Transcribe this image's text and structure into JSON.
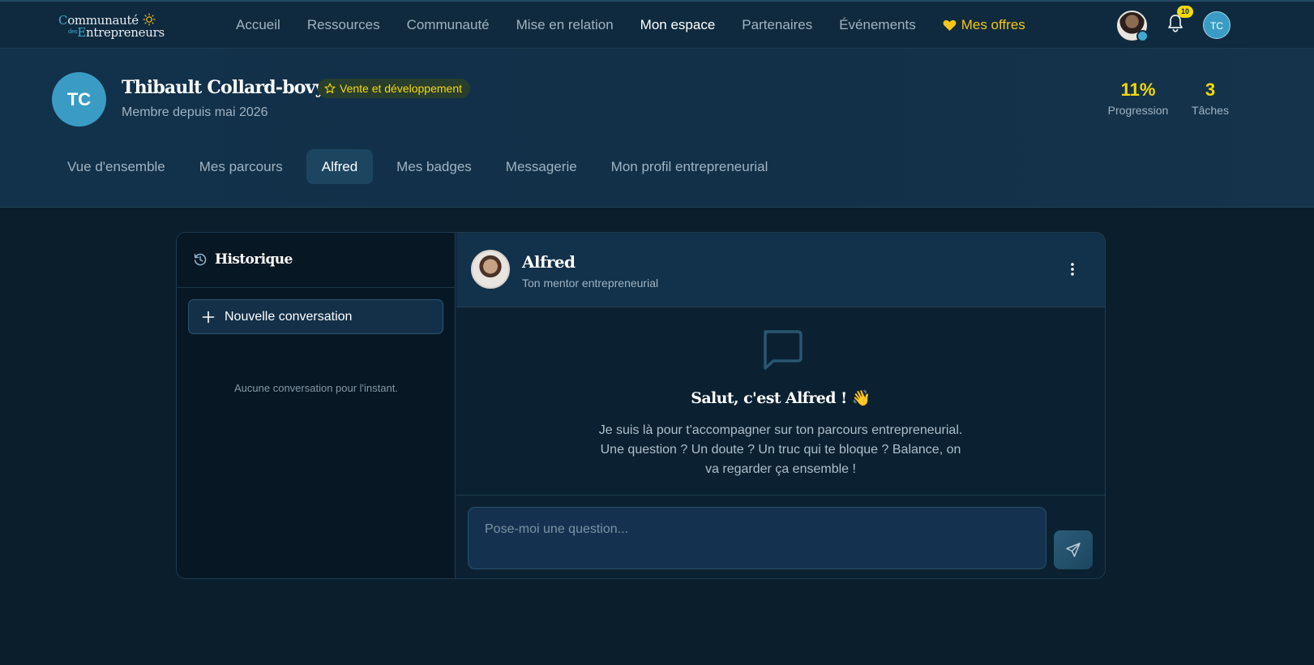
{
  "logo": {
    "line1_first": "C",
    "line1_rest": "ommunauté",
    "line2_small": "des",
    "line2_first": "E",
    "line2_rest": "ntrepreneurs"
  },
  "nav": {
    "links": [
      "Accueil",
      "Ressources",
      "Communauté",
      "Mise en relation",
      "Mon espace",
      "Partenaires",
      "Événements"
    ],
    "active": "Mon espace",
    "offers_label": "Mes offres",
    "notification_count": "10",
    "user_initials": "TC"
  },
  "profile": {
    "initials": "TC",
    "name": "Thibault Collard-bovy",
    "badge": "Vente et développement",
    "member_since": "Membre depuis mai 2026",
    "stats": [
      {
        "value": "11%",
        "label": "Progression"
      },
      {
        "value": "3",
        "label": "Tâches"
      }
    ]
  },
  "tabs": [
    "Vue d'ensemble",
    "Mes parcours",
    "Alfred",
    "Mes badges",
    "Messagerie",
    "Mon profil entrepreneurial"
  ],
  "active_tab": "Alfred",
  "history": {
    "title": "Historique",
    "new_button": "Nouvelle conversation",
    "empty_text": "Aucune conversation pour l'instant."
  },
  "chat": {
    "name": "Alfred",
    "subtitle": "Ton mentor entrepreneurial",
    "welcome_title": "Salut, c'est Alfred ! 👋",
    "welcome_text": "Je suis là pour t'accompagner sur ton parcours entrepreneurial. Une question ? Un doute ? Un truc qui te bloque ? Balance, on va regarder ça ensemble !",
    "input_placeholder": "Pose-moi une question..."
  },
  "colors": {
    "accent": "#3fa9d1",
    "highlight": "#f5d90a",
    "background": "#0a1e2c"
  }
}
